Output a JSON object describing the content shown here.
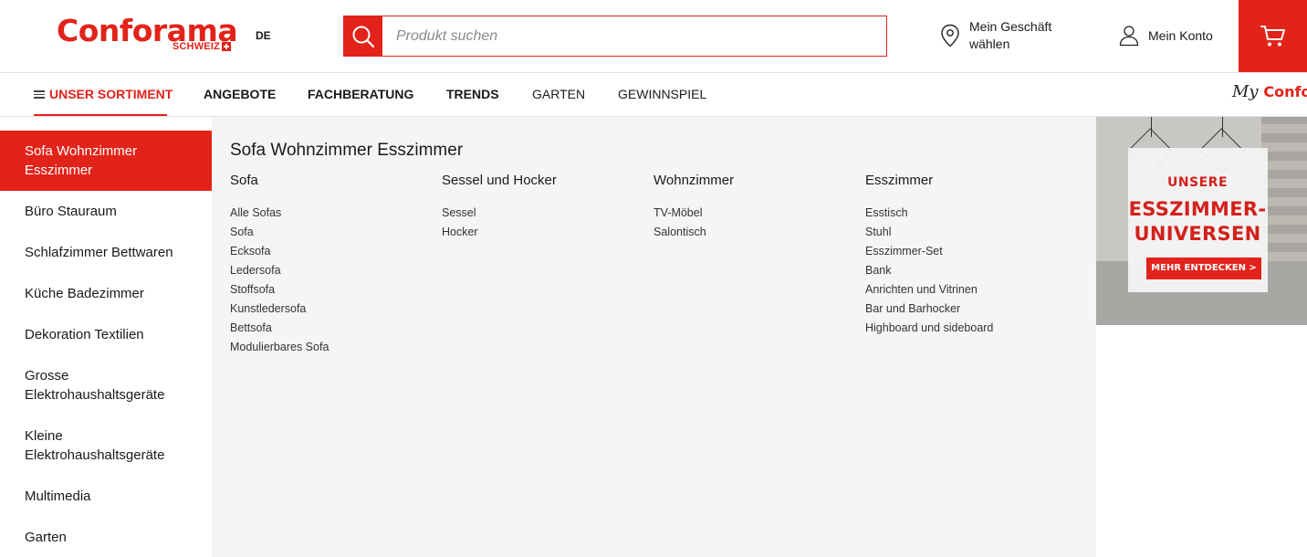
{
  "header": {
    "logo_text": "Conforama",
    "logo_sub": "SCHWEIZ",
    "language": "DE",
    "search_placeholder": "Produkt suchen",
    "store_line1": "Mein Geschäft",
    "store_line2": "wählen",
    "account_label": "Mein Konto"
  },
  "nav": {
    "items": [
      "UNSER SORTIMENT",
      "ANGEBOTE",
      "FACHBERATUNG",
      "TRENDS",
      "GARTEN",
      "GEWINNSPIEL"
    ],
    "myconfo_my": "My",
    "myconfo_brand": "Confo"
  },
  "sidebar": {
    "items": [
      "Sofa Wohnzimmer Esszimmer",
      "Büro Stauraum",
      "Schlafzimmer Bettwaren",
      "Küche Badezimmer",
      "Dekoration Textilien",
      "Grosse Elektrohaushaltsgeräte",
      "Kleine Elektrohaushaltsgeräte",
      "Multimedia",
      "Garten"
    ]
  },
  "panel": {
    "title": "Sofa Wohnzimmer Esszimmer",
    "columns": [
      {
        "heading": "Sofa",
        "links": [
          "Alle Sofas",
          "Sofa",
          "Ecksofa",
          "Ledersofa",
          "Stoffsofa",
          "Kunstledersofa",
          "Bettsofa",
          "Modulierbares Sofa"
        ]
      },
      {
        "heading": "Sessel und Hocker",
        "links": [
          "Sessel",
          "Hocker"
        ]
      },
      {
        "heading": "Wohnzimmer",
        "links": [
          "TV-Möbel",
          "Salontisch"
        ]
      },
      {
        "heading": "Esszimmer",
        "links": [
          "Esstisch",
          "Stuhl",
          "Esszimmer-Set",
          "Bank",
          "Anrichten und Vitrinen",
          "Bar und Barhocker",
          "Highboard und sideboard"
        ]
      }
    ]
  },
  "banner": {
    "line1": "UNSERE",
    "line2": "ESSZIMMER-",
    "line3": "UNIVERSEN",
    "button": "MEHR ENTDECKEN >"
  },
  "colors": {
    "brand_red": "#e2231a",
    "panel_bg": "#f5f5f5"
  }
}
